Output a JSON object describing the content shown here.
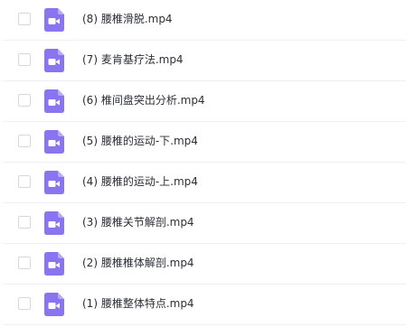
{
  "files": [
    {
      "name": "(8)  腰椎滑脱.mp4",
      "icon": "video-file-icon"
    },
    {
      "name": "(7)  麦肯基疗法.mp4",
      "icon": "video-file-icon"
    },
    {
      "name": "(6)  椎间盘突出分析.mp4",
      "icon": "video-file-icon"
    },
    {
      "name": "(5)  腰椎的运动-下.mp4",
      "icon": "video-file-icon"
    },
    {
      "name": "(4)  腰椎的运动-上.mp4",
      "icon": "video-file-icon"
    },
    {
      "name": "(3)  腰椎关节解剖.mp4",
      "icon": "video-file-icon"
    },
    {
      "name": "(2)  腰椎椎体解剖.mp4",
      "icon": "video-file-icon"
    },
    {
      "name": "(1)  腰椎整体特点.mp4",
      "icon": "video-file-icon"
    }
  ],
  "colors": {
    "video_icon": "#8b74f0",
    "video_icon_fold": "#b9a8f7",
    "text": "#2b2f36",
    "divider": "#eef0f3",
    "checkbox_border": "#d5d8de"
  }
}
